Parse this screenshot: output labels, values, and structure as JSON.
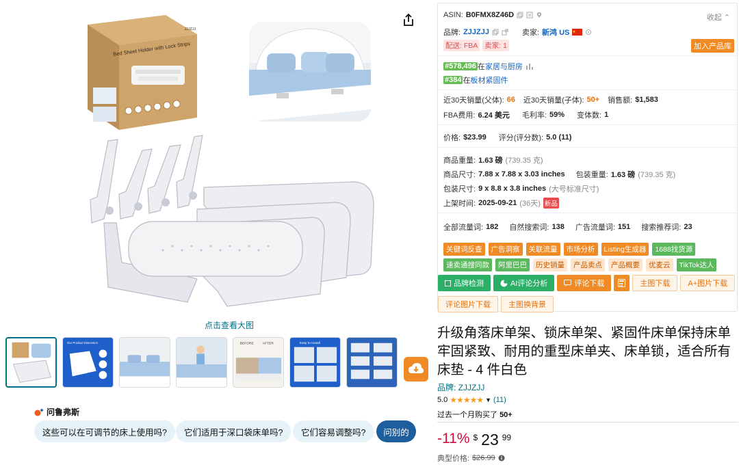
{
  "gallery": {
    "zoom_label": "点击查看大图",
    "box_text": "Bed Sheet Holder with Lock Strips",
    "box_brand": "ZJJZJJ",
    "thumb_count": 7,
    "thumb_2_caption": "Our Product Dimension",
    "thumb_5_before": "BEFORE",
    "thumb_5_after": "AFTER",
    "thumb_6_caption": "Easy to Install"
  },
  "rufus": {
    "title": "问鲁弗斯",
    "questions": [
      "这些可以在可调节的床上使用吗?",
      "它们适用于深口袋床单吗?",
      "它们容易调整吗?"
    ],
    "ask_label": "问别的"
  },
  "panel": {
    "asin_label": "ASIN:",
    "asin": "B0FMX8Z46D",
    "collapse_label": "收起",
    "brand_label": "品牌:",
    "brand": "ZJJZJJ",
    "seller_label": "卖家:",
    "seller": "新鸿 US",
    "ship_label": "配送:",
    "ship_value": "FBA",
    "seller_type": "卖家: 1",
    "add_lib": "加入产品库",
    "rank1": "#578,496",
    "rank1_in": "在",
    "rank1_cat": "家居与厨房",
    "rank2": "#384",
    "rank2_in": "在",
    "rank2_cat": "板材紧固件",
    "sales_parent_label": "近30天销量(父体):",
    "sales_parent": "66",
    "sales_child_label": "近30天销量(子体):",
    "sales_child": "50+",
    "revenue_label": "销售额:",
    "revenue": "$1,583",
    "fba_label": "FBA费用:",
    "fba": "6.24 美元",
    "margin_label": "毛利率:",
    "margin": "59%",
    "variants_label": "变体数:",
    "variants": "1",
    "price_label": "价格:",
    "price": "$23.99",
    "score_label": "评分(评分数):",
    "score": "5.0 (11)",
    "weight_label": "商品重量:",
    "weight": "1.63 磅",
    "weight_g": "(739.35 克)",
    "dims_label": "商品尺寸:",
    "dims": "7.88 x 7.88 x 3.03 inches",
    "pkg_weight_label": "包装重量:",
    "pkg_weight": "1.63 磅",
    "pkg_weight_g": "(739.35 克)",
    "pkg_dims_label": "包装尺寸:",
    "pkg_dims": "9 x 8.8 x 3.8 inches",
    "pkg_dims_note": "(大号标准尺寸)",
    "listed_label": "上架时间:",
    "listed": "2025-09-21",
    "listed_days": "(36天)",
    "new_tag": "新品",
    "traffic_all_label": "全部流量词:",
    "traffic_all": "182",
    "organic_label": "自然搜索词:",
    "organic": "138",
    "ad_label": "广告流量词:",
    "ad": "151",
    "suggest_label": "搜索推荐词:",
    "suggest": "23",
    "tools": [
      {
        "label": "关键词反查",
        "style": "orange"
      },
      {
        "label": "广告洞察",
        "style": "orange"
      },
      {
        "label": "关联流量",
        "style": "orange"
      },
      {
        "label": "市场分析",
        "style": "orange"
      },
      {
        "label": "Listing生成器",
        "style": "orange"
      },
      {
        "label": "1688找货源",
        "style": "green"
      },
      {
        "label": "速卖通搜同款",
        "style": "green"
      },
      {
        "label": "阿里巴巴",
        "style": "green"
      },
      {
        "label": "历史销量",
        "style": "light"
      },
      {
        "label": "产品卖点",
        "style": "light"
      },
      {
        "label": "产品概要",
        "style": "light"
      },
      {
        "label": "优麦云",
        "style": "light"
      },
      {
        "label": "TikTok达人",
        "style": "green"
      }
    ],
    "btn_brand_check": "品牌检测",
    "btn_ai_review": "AI评论分析",
    "btn_review_dl": "评论下载",
    "btn_main_dl": "主图下载",
    "btn_aplus_dl": "A+图片下载",
    "btn_review_img_dl": "评论图片下载",
    "btn_main_bg": "主图换背景"
  },
  "product": {
    "title": "升级角落床单架、锁床单架、紧固件床单保持床单牢固紧致、耐用的重型床单夹、床单锁，适合所有床垫 - 4 件白色",
    "brand_line": "品牌: ZJJZJJ",
    "rating": "5.0",
    "stars": "★★★★★",
    "rating_count": "(11)",
    "bought_prefix": "过去一个月购买了",
    "bought_value": "50+",
    "discount": "-11%",
    "currency": "$",
    "price_whole": "23",
    "price_cents": "99",
    "typical_label": "典型价格:",
    "typical_price": "$26.99"
  },
  "colors": {
    "amazon_link": "#007185",
    "plugin_orange": "#f08a24",
    "plugin_green": "#2bae66",
    "rank_green": "#64bd51",
    "discount_red": "#cc0c39",
    "rufus_blue": "#1e5e9c"
  }
}
